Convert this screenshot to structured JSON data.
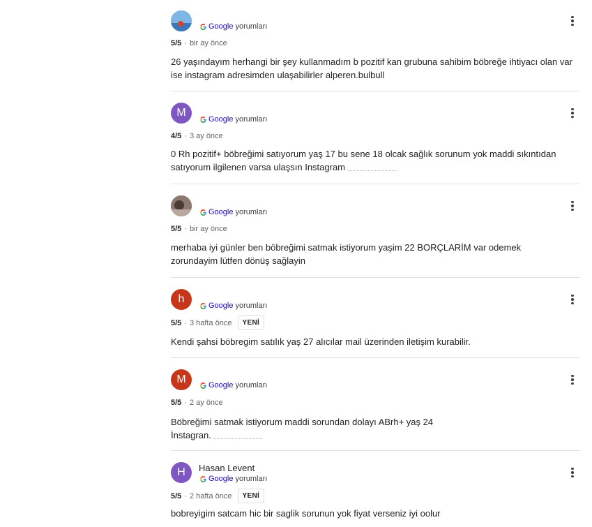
{
  "source_label_brand": "Google",
  "source_label_suffix": "yorumları",
  "new_badge": "YENİ",
  "reviews": [
    {
      "avatar_letter": "",
      "avatar_color": "#4a90c8",
      "name": "",
      "rating": "5/5",
      "time": "bir ay önce",
      "new": false,
      "text": "26 yaşındayım herhangi bir şey kullanmadım b pozitif kan grubuna sahibim böbreğe ihtiyacı olan var ise instagram adresimden ulaşabilirler alperen.bulbull"
    },
    {
      "avatar_letter": "M",
      "avatar_color": "#7e57c2",
      "name": "",
      "rating": "4/5",
      "time": "3 ay önce",
      "new": false,
      "text": "0 Rh pozitif+ böbreğimi satıyorum yaş 17 bu sene 18 olcak sağlık sorunum yok maddi sıkıntıdan satıyorum ilgilenen varsa ulaşsın Instagram"
    },
    {
      "avatar_letter": "",
      "avatar_color": "#6d5a52",
      "name": "",
      "rating": "5/5",
      "time": "bir ay önce",
      "new": false,
      "text": "merhaba iyi günler ben böbreğimi satmak istiyorum yaşim 22 BORÇLARİM var odemek zorundayim lütfen dönüş sağlayin"
    },
    {
      "avatar_letter": "h",
      "avatar_color": "#c5361b",
      "name": "",
      "rating": "5/5",
      "time": "3 hafta önce",
      "new": true,
      "text": "Kendi şahsi böbregim satılık yaş 27 alıcılar mail üzerinden iletişim kurabilir."
    },
    {
      "avatar_letter": "M",
      "avatar_color": "#c5361b",
      "name": "",
      "rating": "5/5",
      "time": "2 ay önce",
      "new": false,
      "text": "Böbreğimi satmak istiyorum maddi sorundan dolayı ABrh+ yaş 24 İnstagran."
    },
    {
      "avatar_letter": "H",
      "avatar_color": "#7e57c2",
      "name": "Hasan Levent",
      "rating": "5/5",
      "time": "2 hafta önce",
      "new": true,
      "text": "bobreyigim satcam hic bir saglik sorunun yok fiyat verseniz iyi oolur"
    }
  ]
}
